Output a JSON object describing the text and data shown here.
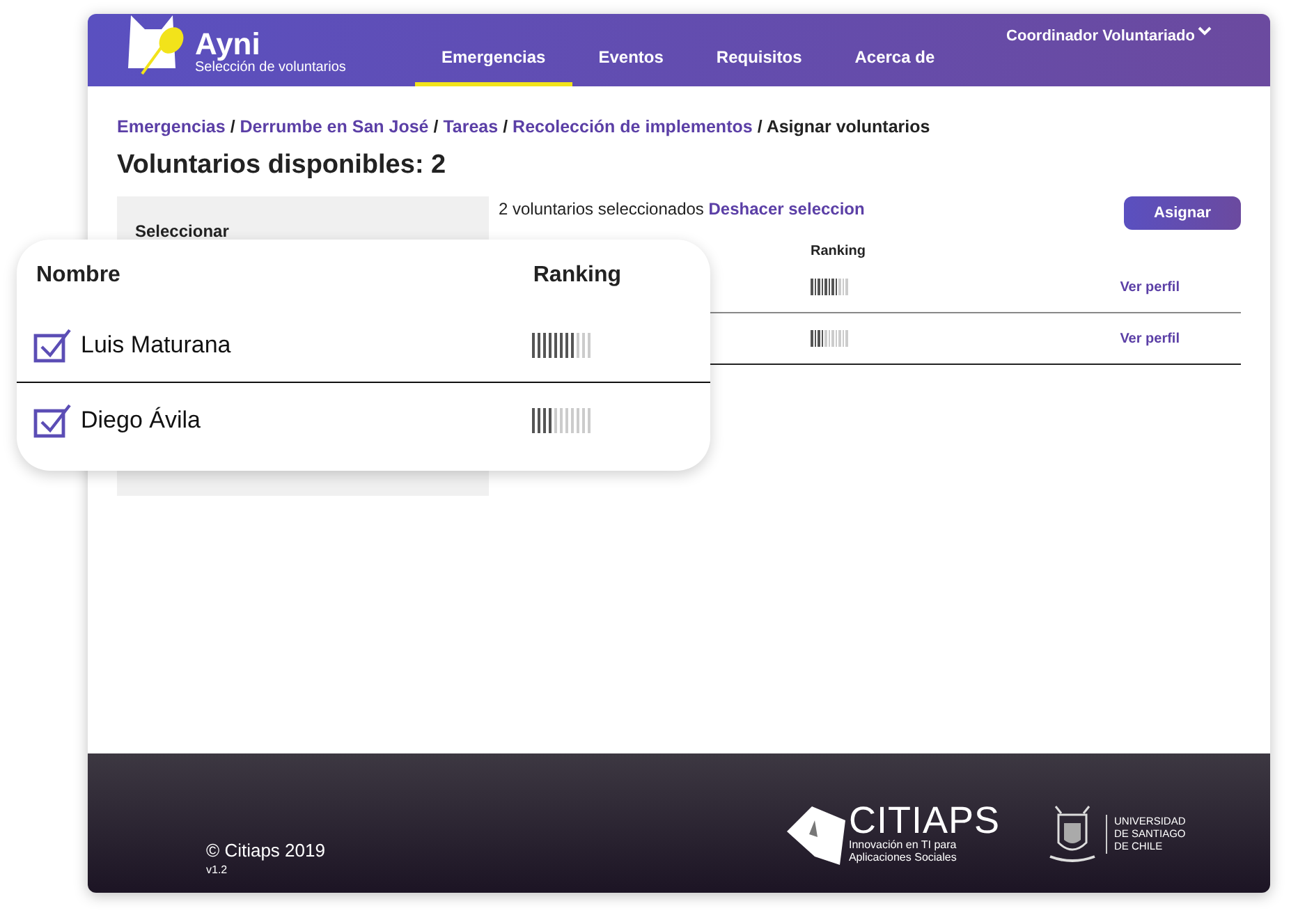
{
  "header": {
    "app_name": "Ayni",
    "subtitle": "Selección de voluntarios",
    "nav": [
      {
        "label": "Emergencias",
        "selected": true
      },
      {
        "label": "Eventos",
        "selected": false
      },
      {
        "label": "Requisitos",
        "selected": false
      },
      {
        "label": "Acerca de",
        "selected": false
      }
    ],
    "user_menu": "Coordinador Voluntariado"
  },
  "breadcrumb_separator": "/",
  "breadcrumb": [
    {
      "label": "Emergencias",
      "kind": "link"
    },
    {
      "label": "Derrumbe en San José",
      "kind": "link"
    },
    {
      "label": "Tareas",
      "kind": "link"
    },
    {
      "label": "Recolección de implementos",
      "kind": "link"
    },
    {
      "label": "Asignar voluntarios",
      "kind": "current"
    }
  ],
  "heading": "Voluntarios disponibles: 2",
  "sidebar": {
    "title": "Seleccionar"
  },
  "selection": {
    "count_text": "2 voluntarios seleccionados",
    "undo_link": "Deshacer seleccion"
  },
  "assign_button": "Asignar",
  "table": {
    "columns": [
      "Ranking"
    ],
    "rows": [
      {
        "level": 0.7,
        "link": "Ver perfil"
      },
      {
        "level": 0.35,
        "link": "Ver perfil"
      }
    ]
  },
  "callout": {
    "columns": [
      "Nombre",
      "Ranking"
    ],
    "rows": [
      {
        "name": "Luis Maturana",
        "checked": true,
        "level": 0.7
      },
      {
        "name": "Diego Ávila",
        "checked": true,
        "level": 0.35
      }
    ]
  },
  "footer": {
    "copyright": "© Citiaps 2019",
    "version": "v1.2",
    "citiaps": {
      "name": "CITIAPS",
      "lines": [
        "Innovación en TI para",
        "Aplicaciones Sociales"
      ]
    },
    "university": [
      "UNIVERSIDAD",
      "DE SANTIAGO",
      "DE CHILE"
    ]
  }
}
